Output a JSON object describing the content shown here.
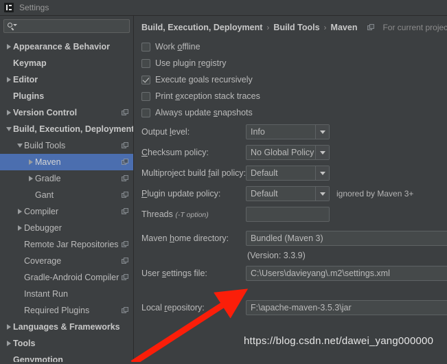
{
  "window": {
    "title": "Settings",
    "logo_icon": "intellij-idea-icon"
  },
  "sidebar": {
    "search": {
      "value": "",
      "placeholder": "",
      "icon": "search-icon"
    },
    "items": [
      {
        "label": "Appearance & Behavior",
        "arrow": "collapsed",
        "indent": 0,
        "bold": true,
        "scope_icon": false,
        "selected": false
      },
      {
        "label": "Keymap",
        "arrow": "none",
        "indent": 0,
        "bold": true,
        "scope_icon": false,
        "selected": false
      },
      {
        "label": "Editor",
        "arrow": "collapsed",
        "indent": 0,
        "bold": true,
        "scope_icon": false,
        "selected": false
      },
      {
        "label": "Plugins",
        "arrow": "none",
        "indent": 0,
        "bold": true,
        "scope_icon": false,
        "selected": false
      },
      {
        "label": "Version Control",
        "arrow": "collapsed",
        "indent": 0,
        "bold": true,
        "scope_icon": true,
        "selected": false
      },
      {
        "label": "Build, Execution, Deployment",
        "arrow": "expanded",
        "indent": 0,
        "bold": true,
        "scope_icon": false,
        "selected": false
      },
      {
        "label": "Build Tools",
        "arrow": "expanded",
        "indent": 1,
        "bold": false,
        "scope_icon": true,
        "selected": false
      },
      {
        "label": "Maven",
        "arrow": "collapsed",
        "indent": 2,
        "bold": false,
        "scope_icon": true,
        "selected": true
      },
      {
        "label": "Gradle",
        "arrow": "collapsed",
        "indent": 2,
        "bold": false,
        "scope_icon": true,
        "selected": false
      },
      {
        "label": "Gant",
        "arrow": "none",
        "indent": 2,
        "bold": false,
        "scope_icon": true,
        "selected": false
      },
      {
        "label": "Compiler",
        "arrow": "collapsed",
        "indent": 1,
        "bold": false,
        "scope_icon": true,
        "selected": false
      },
      {
        "label": "Debugger",
        "arrow": "collapsed",
        "indent": 1,
        "bold": false,
        "scope_icon": false,
        "selected": false
      },
      {
        "label": "Remote Jar Repositories",
        "arrow": "none",
        "indent": 1,
        "bold": false,
        "scope_icon": true,
        "selected": false
      },
      {
        "label": "Coverage",
        "arrow": "none",
        "indent": 1,
        "bold": false,
        "scope_icon": true,
        "selected": false
      },
      {
        "label": "Gradle-Android Compiler",
        "arrow": "none",
        "indent": 1,
        "bold": false,
        "scope_icon": true,
        "selected": false
      },
      {
        "label": "Instant Run",
        "arrow": "none",
        "indent": 1,
        "bold": false,
        "scope_icon": false,
        "selected": false
      },
      {
        "label": "Required Plugins",
        "arrow": "none",
        "indent": 1,
        "bold": false,
        "scope_icon": true,
        "selected": false
      },
      {
        "label": "Languages & Frameworks",
        "arrow": "collapsed",
        "indent": 0,
        "bold": true,
        "scope_icon": false,
        "selected": false
      },
      {
        "label": "Tools",
        "arrow": "collapsed",
        "indent": 0,
        "bold": true,
        "scope_icon": false,
        "selected": false
      },
      {
        "label": "Genymotion",
        "arrow": "none",
        "indent": 0,
        "bold": true,
        "scope_icon": false,
        "selected": false
      }
    ]
  },
  "main": {
    "breadcrumb": {
      "parts": [
        "Build, Execution, Deployment",
        "Build Tools",
        "Maven"
      ],
      "separator": "›"
    },
    "scope_note": {
      "label": "For current project",
      "icon": "project-scope-icon"
    },
    "checkboxes": [
      {
        "label_pre": "Work ",
        "mnemonic": "o",
        "label_post": "ffline",
        "checked": false
      },
      {
        "label_pre": "Use plugin ",
        "mnemonic": "r",
        "label_post": "egistry",
        "checked": false
      },
      {
        "label_pre": "Execute ",
        "mnemonic": "g",
        "label_post": "oals recursively",
        "checked": true
      },
      {
        "label_pre": "Print ",
        "mnemonic": "e",
        "label_post": "xception stack traces",
        "checked": false
      },
      {
        "label_pre": "Always update ",
        "mnemonic": "s",
        "label_post": "napshots",
        "checked": false
      }
    ],
    "combos": [
      {
        "label_pre": "Output ",
        "mnemonic": "l",
        "label_post": "evel:",
        "value": "Info",
        "note": ""
      },
      {
        "label_pre": "",
        "mnemonic": "C",
        "label_post": "hecksum policy:",
        "value": "No Global Policy",
        "note": ""
      },
      {
        "label_pre": "Multiproject build ",
        "mnemonic": "f",
        "label_post": "ail policy:",
        "value": "Default",
        "note": ""
      },
      {
        "label_pre": "",
        "mnemonic": "P",
        "label_post": "lugin update policy:",
        "value": "Default",
        "note": "ignored by Maven 3+"
      }
    ],
    "threads": {
      "label_pre": "Threads ",
      "label_italic": "(-T option)",
      "value": ""
    },
    "maven_home": {
      "label_pre": "Maven ",
      "mnemonic": "h",
      "label_post": "ome directory:",
      "value": "Bundled (Maven 3)",
      "version_note": "(Version: 3.3.9)"
    },
    "user_settings": {
      "label_pre": "User ",
      "mnemonic": "s",
      "label_post": "ettings file:",
      "value": "C:\\Users\\davieyang\\.m2\\settings.xml"
    },
    "local_repository": {
      "label_pre": "Local ",
      "mnemonic": "r",
      "label_post": "epository:",
      "value": "F:\\apache-maven-3.5.3\\jar"
    }
  },
  "annotation": {
    "arrow_color": "#fb1e09",
    "watermark": "https://blog.csdn.net/dawei_yang000000"
  }
}
